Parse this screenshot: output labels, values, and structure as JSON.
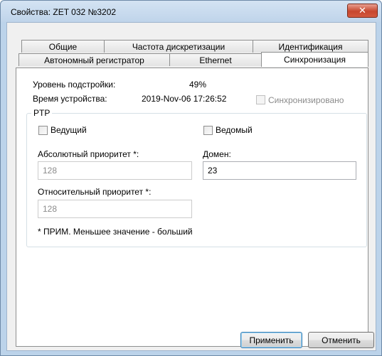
{
  "window": {
    "title": "Свойства: ZET 032 №3202",
    "close_glyph": "✕"
  },
  "tabs": {
    "row1": [
      "Общие",
      "Частота дискретизации",
      "Идентификация"
    ],
    "row2": [
      "Автономный регистратор",
      "Ethernet",
      "Синхронизация"
    ],
    "active": "Синхронизация"
  },
  "sync": {
    "tuning_level_label": "Уровень подстройки:",
    "tuning_level_value": "49%",
    "device_time_label": "Время устройства:",
    "device_time_value": "2019-Nov-06 17:26:52",
    "synchronized_label": "Синхронизировано"
  },
  "ptp": {
    "group_title": "PTP",
    "master_label": "Ведущий",
    "slave_label": "Ведомый",
    "absolute_priority_label": "Абсолютный приоритет *:",
    "absolute_priority_value": "128",
    "domain_label": "Домен:",
    "domain_value": "23",
    "relative_priority_label": "Относительный приоритет *:",
    "relative_priority_value": "128",
    "note": "* ПРИМ. Меньшее значение - больший"
  },
  "buttons": {
    "apply": "Применить",
    "cancel": "Отменить"
  }
}
